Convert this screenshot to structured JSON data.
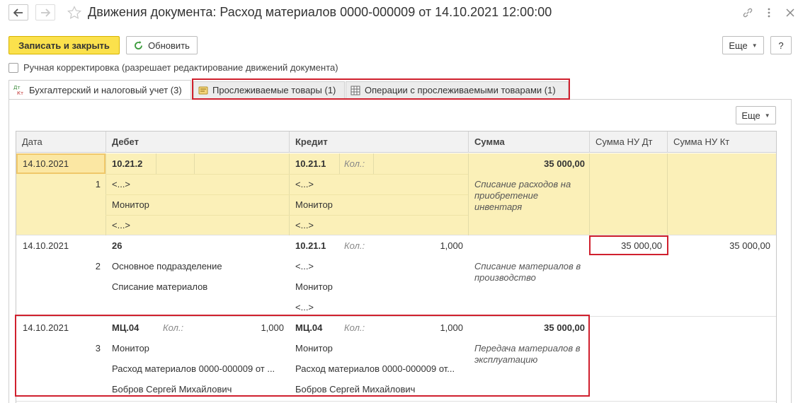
{
  "window": {
    "title": "Движения документа: Расход материалов 0000-000009 от 14.10.2021 12:00:00"
  },
  "toolbar": {
    "save_close_label": "Записать и закрыть",
    "refresh_label": "Обновить",
    "more_label": "Еще",
    "help_label": "?"
  },
  "manual_edit": {
    "label": "Ручная корректировка (разрешает редактирование движений документа)",
    "checked": false
  },
  "tabs": [
    {
      "label": "Бухгалтерский и налоговый учет (3)",
      "active": true
    },
    {
      "label": "Прослеживаемые товары (1)",
      "active": false
    },
    {
      "label": "Операции с прослеживаемыми товарами (1)",
      "active": false
    }
  ],
  "tab_icon_text": {
    "top": "Дт",
    "bottom": "Кт"
  },
  "grid_toolbar": {
    "more_label": "Еще"
  },
  "table": {
    "columns": [
      "Дата",
      "Дебет",
      "Кредит",
      "Сумма",
      "Сумма НУ Дт",
      "Сумма НУ Кт"
    ],
    "qty_label": "Кол.:",
    "rows": [
      {
        "date": "14.10.2021",
        "num": "1",
        "debit": {
          "account": "10.21.2",
          "qty": "",
          "lines": [
            "<...>",
            "Монитор",
            "<...>"
          ]
        },
        "credit": {
          "account": "10.21.1",
          "qty": "",
          "lines": [
            "<...>",
            "Монитор",
            "<...>"
          ]
        },
        "sum": "35 000,00",
        "comment": "Списание расходов на приобретение инвентаря",
        "nu_dt": "",
        "nu_kt": ""
      },
      {
        "date": "14.10.2021",
        "num": "2",
        "debit": {
          "account": "26",
          "qty": "",
          "lines": [
            "Основное подразделение",
            "Списание материалов"
          ]
        },
        "credit": {
          "account": "10.21.1",
          "qty": "1,000",
          "lines": [
            "<...>",
            "Монитор",
            "<...>"
          ]
        },
        "sum": "",
        "comment": "Списание материалов в производство",
        "nu_dt": "35 000,00",
        "nu_kt": "35 000,00"
      },
      {
        "date": "14.10.2021",
        "num": "3",
        "debit": {
          "account": "МЦ.04",
          "qty": "1,000",
          "lines": [
            "Монитор",
            "Расход материалов 0000-000009 от ...",
            "Бобров Сергей Михайлович"
          ]
        },
        "credit": {
          "account": "МЦ.04",
          "qty": "1,000",
          "lines": [
            "Монитор",
            "Расход материалов 0000-000009 от...",
            "Бобров Сергей Михайлович"
          ]
        },
        "sum": "35 000,00",
        "comment": "Передача материалов в эксплуатацию",
        "nu_dt": "",
        "nu_kt": ""
      }
    ]
  },
  "colors": {
    "accent_yellow": "#fbe14c",
    "selected_row": "#fbf0b8",
    "highlight_red": "#d0202e"
  }
}
